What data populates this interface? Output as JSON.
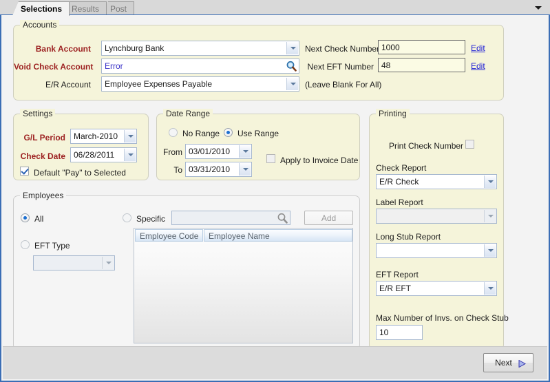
{
  "window": {
    "tabs": [
      {
        "label": "Selections",
        "active": true
      },
      {
        "label": "Results",
        "active": false
      },
      {
        "label": "Post",
        "active": false
      }
    ],
    "tab_menu_icon": "chevron-down-icon"
  },
  "accounts": {
    "legend": "Accounts",
    "bank_account": {
      "label": "Bank Account",
      "value": "Lynchburg Bank",
      "dropdown_icon": "chevron-down-icon"
    },
    "void_check_account": {
      "label": "Void Check Account",
      "value": "Error",
      "lookup_icon": "magnifier-icon"
    },
    "er_account": {
      "label": "E/R Account",
      "value": "Employee Expenses Payable",
      "dropdown_icon": "chevron-down-icon"
    },
    "next_check_number": {
      "label": "Next Check Number",
      "value": "1000",
      "edit_label": "Edit"
    },
    "next_eft_number": {
      "label": "Next EFT Number",
      "value": "48",
      "edit_label": "Edit"
    },
    "blank_hint": "(Leave Blank For All)"
  },
  "settings": {
    "legend": "Settings",
    "gl_period": {
      "label": "G/L Period",
      "value": "March-2010",
      "dropdown_icon": "chevron-down-icon"
    },
    "check_date": {
      "label": "Check Date",
      "value": "06/28/2011",
      "dropdown_icon": "chevron-down-icon"
    },
    "default_pay": {
      "label": "Default \"Pay\"  to Selected",
      "checked": true
    }
  },
  "date_range": {
    "legend": "Date Range",
    "no_range": {
      "label": "No Range",
      "selected": false
    },
    "use_range": {
      "label": "Use Range",
      "selected": true
    },
    "from": {
      "label": "From",
      "value": "03/01/2010",
      "dropdown_icon": "chevron-down-icon"
    },
    "to": {
      "label": "To",
      "value": "03/31/2010",
      "dropdown_icon": "chevron-down-icon"
    },
    "apply_invoice_date": {
      "label": "Apply to Invoice Date",
      "checked": false
    }
  },
  "printing": {
    "legend": "Printing",
    "print_check_number": {
      "label": "Print Check Number",
      "checked": false
    },
    "check_report": {
      "label": "Check Report",
      "value": "E/R Check",
      "dropdown_icon": "chevron-down-icon"
    },
    "label_report": {
      "label": "Label Report",
      "value": "",
      "dropdown_icon": "chevron-down-icon"
    },
    "long_stub_report": {
      "label": "Long Stub Report",
      "value": "",
      "dropdown_icon": "chevron-down-icon"
    },
    "eft_report": {
      "label": "EFT Report",
      "value": "E/R EFT",
      "dropdown_icon": "chevron-down-icon"
    },
    "max_invs": {
      "label": "Max Number of Invs. on Check Stub",
      "value": "10"
    }
  },
  "employees": {
    "legend": "Employees",
    "all": {
      "label": "All",
      "selected": true
    },
    "eft_type": {
      "label": "EFT Type",
      "selected": false,
      "value": "",
      "dropdown_icon": "chevron-down-icon"
    },
    "specific": {
      "label": "Specific",
      "selected": false,
      "value": "",
      "lookup_icon": "magnifier-icon"
    },
    "add_button": "Add",
    "grid": {
      "columns": [
        "Employee Code",
        "Employee Name"
      ],
      "rows": []
    }
  },
  "footer": {
    "next_button": {
      "label": "Next",
      "icon": "play-triangle-icon"
    }
  },
  "colors": {
    "panel_cream": "#f5f4da",
    "required_label": "#9d2222",
    "link": "#2121d6",
    "window_border": "#3b6eb5",
    "error_text": "#3a32c8"
  }
}
